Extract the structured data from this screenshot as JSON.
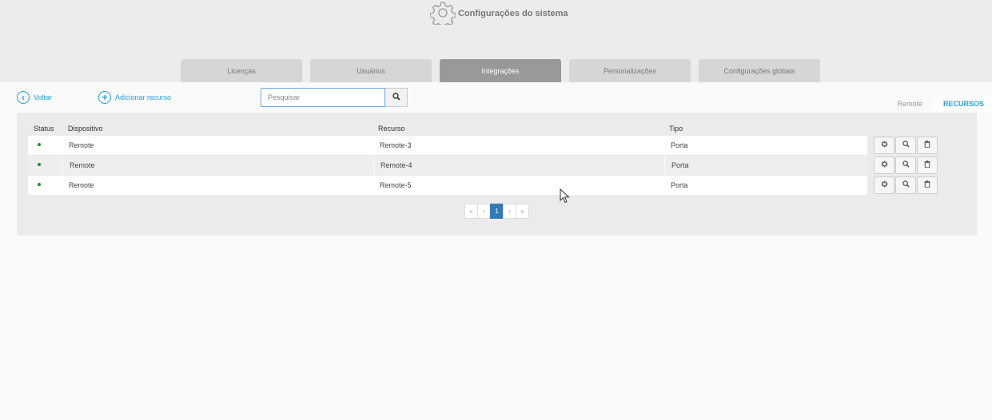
{
  "header": {
    "title": "Configurações do sistema",
    "icon": "gear-icon"
  },
  "tabs": [
    {
      "label": "Licenças",
      "active": false
    },
    {
      "label": "Usuários",
      "active": false
    },
    {
      "label": "Integrações",
      "active": true
    },
    {
      "label": "Personalizações",
      "active": false
    },
    {
      "label": "Configurações globais",
      "active": false
    }
  ],
  "toolbar": {
    "back_label": "Voltar",
    "add_label": "Adicionar recurso",
    "search_placeholder": "Pesquisar"
  },
  "view_tabs": {
    "remote": "Remote",
    "resources": "RECURSOS"
  },
  "table": {
    "headers": {
      "status": "Status",
      "device": "Dispositivo",
      "resource": "Recurso",
      "type": "Tipo"
    },
    "rows": [
      {
        "status": "online",
        "device": "Remote",
        "resource": "Remote-3",
        "type": "Porta"
      },
      {
        "status": "online",
        "device": "Remote",
        "resource": "Remote-4",
        "type": "Porta"
      },
      {
        "status": "online",
        "device": "Remote",
        "resource": "Remote-5",
        "type": "Porta"
      }
    ]
  },
  "pagination": {
    "first": "«",
    "prev": "‹",
    "current": "1",
    "next": "›",
    "last": "»"
  },
  "colors": {
    "accent": "#2a9fd8",
    "status_online": "#2e8b2e",
    "active_tab": "#999999",
    "page_active": "#337ab7"
  }
}
